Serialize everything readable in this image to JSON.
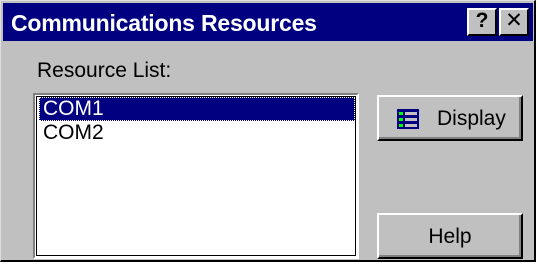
{
  "window": {
    "title": "Communications Resources",
    "help_button": "?",
    "close_button": "✕"
  },
  "resource_list": {
    "label": "Resource List:",
    "items": [
      {
        "label": "COM1",
        "selected": true
      },
      {
        "label": "COM2",
        "selected": false
      }
    ]
  },
  "buttons": {
    "display_label": "Display",
    "help_label": "Help"
  },
  "icons": {
    "display": "list-display-icon"
  },
  "colors": {
    "titlebar": "#000080",
    "face": "#c0c0c0",
    "selection": "#000080"
  }
}
